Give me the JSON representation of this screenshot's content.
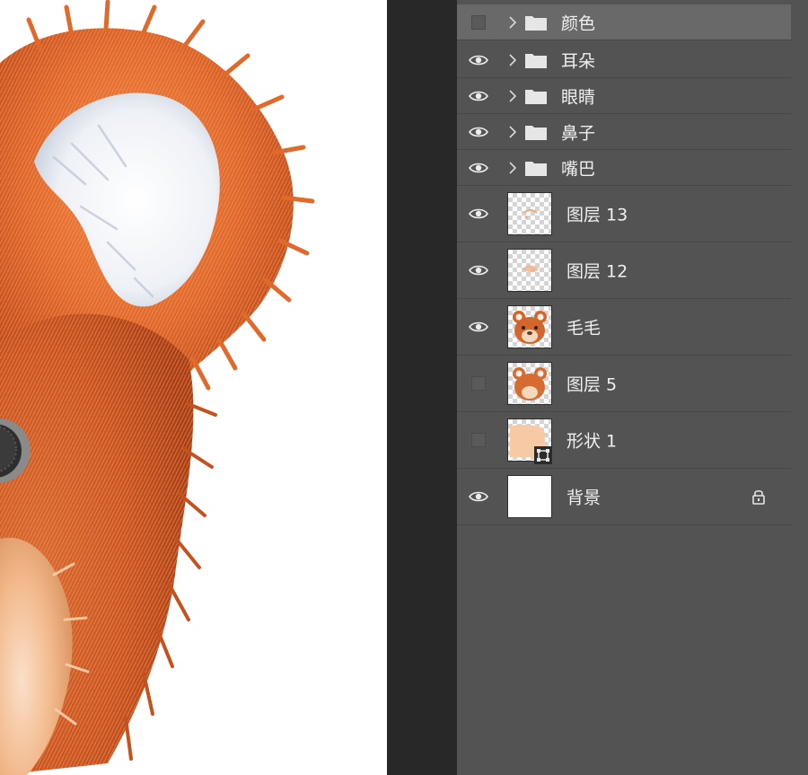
{
  "layers": [
    {
      "name": "颜色",
      "kind": "group",
      "visible": false,
      "selected": true
    },
    {
      "name": "耳朵",
      "kind": "group",
      "visible": true
    },
    {
      "name": "眼睛",
      "kind": "group",
      "visible": true
    },
    {
      "name": "鼻子",
      "kind": "group",
      "visible": true
    },
    {
      "name": "嘴巴",
      "kind": "group",
      "visible": true
    },
    {
      "name": "图层 13",
      "kind": "pixel",
      "visible": true,
      "thumb": "sketch-strokes"
    },
    {
      "name": "图层 12",
      "kind": "pixel",
      "visible": true,
      "thumb": "sketch-strokes"
    },
    {
      "name": "毛毛",
      "kind": "pixel",
      "visible": true,
      "thumb": "bear-head"
    },
    {
      "name": "图层 5",
      "kind": "pixel",
      "visible": false,
      "thumb": "bear-head"
    },
    {
      "name": "形状 1",
      "kind": "shape",
      "visible": false,
      "thumb": "peach-shape"
    },
    {
      "name": "背景",
      "kind": "background",
      "visible": true,
      "locked": true,
      "thumb": "white"
    }
  ],
  "icons": {
    "visibility": "eye-icon",
    "expand": "chevron-right-icon",
    "group": "folder-icon",
    "lock": "lock-icon",
    "vector_mask": "vector-mask-icon"
  },
  "colors": {
    "panel_bg": "#535353",
    "selected_row": "#696969",
    "divider": "#282828",
    "canvas_bg": "#ffffff",
    "fur_orange": "#d9662a",
    "inner_ear": "#eef1f6",
    "peach_fur": "#f2b98c"
  }
}
